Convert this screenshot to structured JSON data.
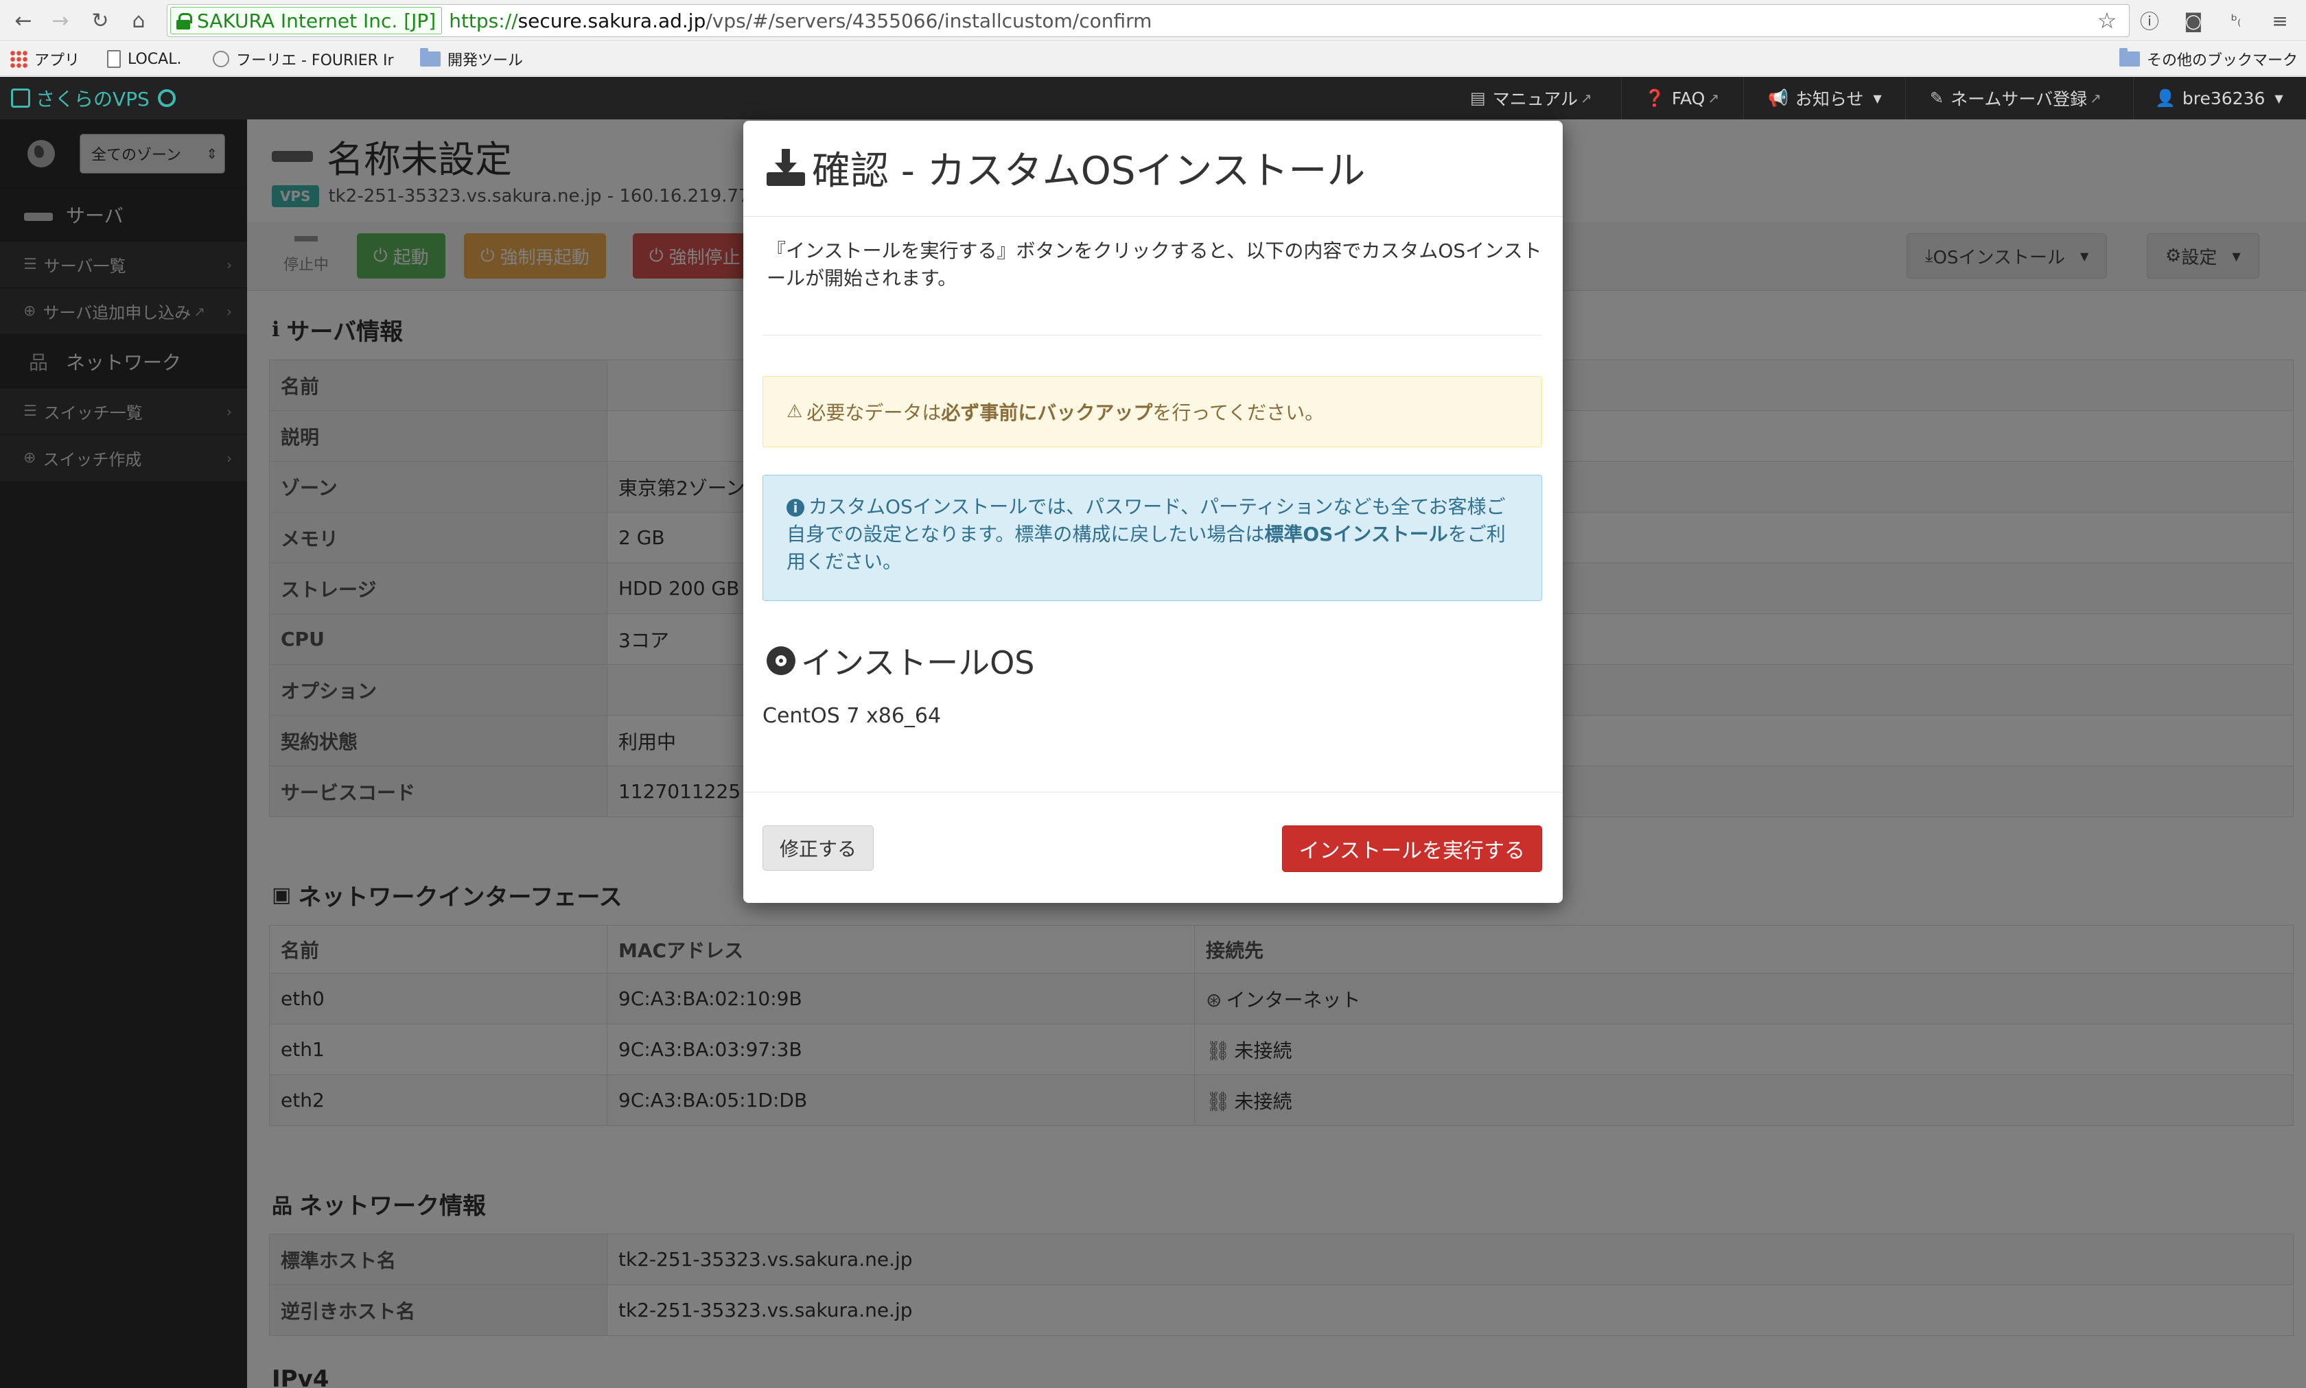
{
  "browser": {
    "ssl_org": "SAKURA Internet Inc. [JP]",
    "url_scheme": "https://",
    "url_host": "secure.sakura.ad.jp",
    "url_path": "/vps/#/servers/4355066/installcustom/confirm",
    "bookmarks": [
      {
        "label": "アプリ",
        "icon": "apps-icon"
      },
      {
        "label": "LOCAL.",
        "icon": "document-icon"
      },
      {
        "label": "フーリエ - FOURIER Ir",
        "icon": "globe-icon"
      },
      {
        "label": "開発ツール",
        "icon": "folder-icon"
      }
    ],
    "other_bookmarks": "その他のブックマーク"
  },
  "navbar": {
    "brand": "さくらのVPS",
    "links": {
      "manual": "マニュアル",
      "faq": "FAQ",
      "news": "お知らせ",
      "nameserver": "ネームサーバ登録",
      "user": "bre36236"
    }
  },
  "sidebar": {
    "zone_select": "全てのゾーン",
    "server_heading": "サーバ",
    "server_list": "サーバ一覧",
    "server_add": "サーバ追加申し込み",
    "network_heading": "ネットワーク",
    "switch_list": "スイッチ一覧",
    "switch_create": "スイッチ作成"
  },
  "server": {
    "title": "名称未設定",
    "badge": "VPS",
    "hostline": "tk2-251-35323.vs.sakura.ne.jp - 160.16.219.77",
    "status": "停止中",
    "btn_start": "起動",
    "btn_force_restart": "強制再起動",
    "btn_force_stop": "強制停止",
    "btn_os_install": "OSインストール",
    "btn_settings": "設定"
  },
  "server_info": {
    "title": "サーバ情報",
    "rows": [
      {
        "key": "名前",
        "value": ""
      },
      {
        "key": "説明",
        "value": ""
      },
      {
        "key": "ゾーン",
        "value": "東京第2ゾーン"
      },
      {
        "key": "メモリ",
        "value": "2 GB"
      },
      {
        "key": "ストレージ",
        "value": "HDD 200 GB"
      },
      {
        "key": "CPU",
        "value": "3コア"
      },
      {
        "key": "オプション",
        "value": ""
      },
      {
        "key": "契約状態",
        "value": "利用中"
      },
      {
        "key": "サービスコード",
        "value": "1127011225"
      }
    ]
  },
  "network_if": {
    "title": "ネットワークインターフェース",
    "headers": [
      "名前",
      "MACアドレス",
      "接続先"
    ],
    "rows": [
      {
        "name": "eth0",
        "mac": "9C:A3:BA:02:10:9B",
        "conn": "インターネット",
        "icon": "globe-icon"
      },
      {
        "name": "eth1",
        "mac": "9C:A3:BA:03:97:3B",
        "conn": "未接続",
        "icon": "unlink-icon"
      },
      {
        "name": "eth2",
        "mac": "9C:A3:BA:05:1D:DB",
        "conn": "未接続",
        "icon": "unlink-icon"
      }
    ]
  },
  "network_info": {
    "title": "ネットワーク情報",
    "rows": [
      {
        "key": "標準ホスト名",
        "value": "tk2-251-35323.vs.sakura.ne.jp"
      },
      {
        "key": "逆引きホスト名",
        "value": "tk2-251-35323.vs.sakura.ne.jp"
      }
    ],
    "next_title": "IPv4"
  },
  "modal": {
    "title": "確認 - カスタムOSインストール",
    "intro": "『インストールを実行する』ボタンをクリックすると、以下の内容でカスタムOSインストールが開始されます。",
    "warning_pre": "必要なデータは",
    "warning_strong": "必ず事前にバックアップ",
    "warning_post": "を行ってください。",
    "info_pre": "カスタムOSインストールでは、パスワード、パーティションなども全てお客様ご自身での設定となります。標準の構成に戻したい場合は",
    "info_strong": "標準OSインストール",
    "info_post": "をご利用ください。",
    "os_heading": "インストールOS",
    "os_value": "CentOS 7 x86_64",
    "edit_button": "修正する",
    "execute_button": "インストールを実行する"
  },
  "colors": {
    "brand": "#3fb8af",
    "danger": "#c9302c",
    "warning_bg": "#fcf8e3",
    "info_bg": "#d9edf7"
  }
}
